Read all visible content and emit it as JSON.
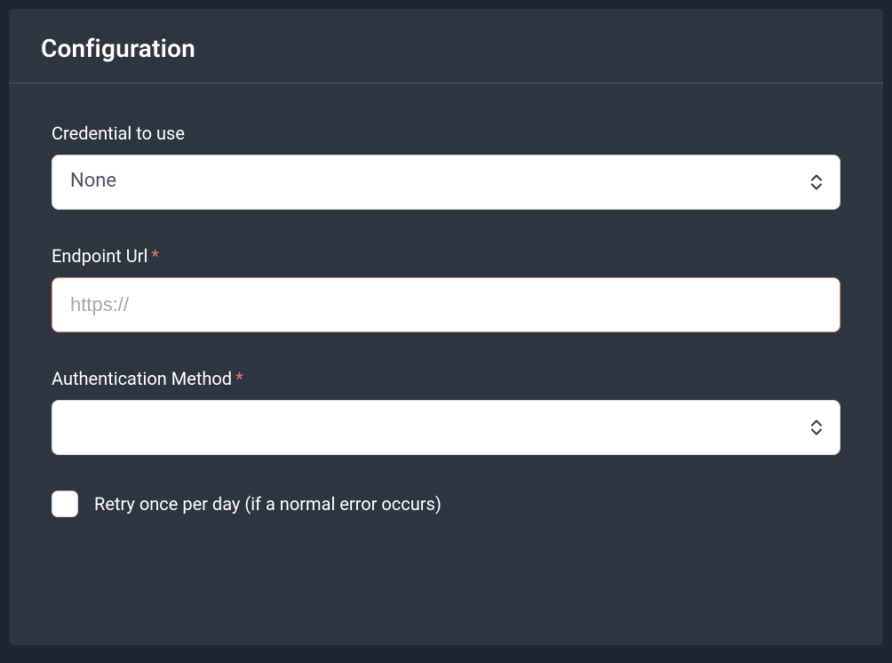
{
  "panel": {
    "title": "Configuration"
  },
  "form": {
    "credential": {
      "label": "Credential to use",
      "value": "None"
    },
    "endpoint": {
      "label": "Endpoint Url",
      "required_mark": "*",
      "placeholder": "https://",
      "value": ""
    },
    "auth_method": {
      "label": "Authentication Method",
      "required_mark": "*",
      "value": ""
    },
    "retry": {
      "label": "Retry once per day (if a normal error occurs)",
      "checked": false
    }
  }
}
